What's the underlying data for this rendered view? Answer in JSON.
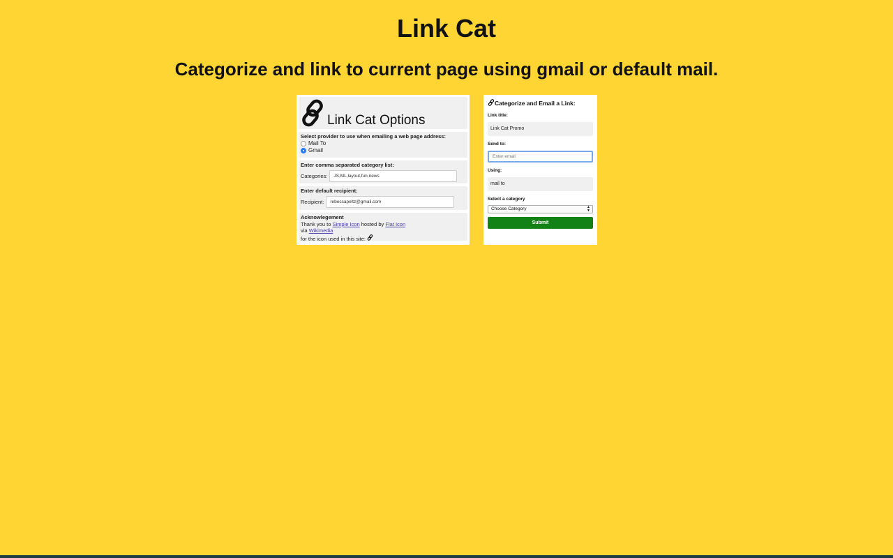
{
  "page": {
    "title": "Link Cat",
    "subtitle": "Categorize and link to current page using gmail or default mail.",
    "background_color": "#ffd533"
  },
  "options_panel": {
    "header_title": "Link Cat Options",
    "header_icon": "link-icon",
    "provider_label": "Select provider to use when emailing a web page address:",
    "providers": [
      {
        "label": "Mail To",
        "selected": false
      },
      {
        "label": "Gmail",
        "selected": true
      }
    ],
    "category_section_label": "Enter comma separated category list:",
    "categories_label": "Categories:",
    "categories_value": "JS,ML,layout,fun,news",
    "recipient_section_label": "Enter default recipient:",
    "recipient_label": "Recipient:",
    "recipient_value": "rebeccapeltz@gmail.com",
    "ack_title": "Acknowlegement",
    "ack_text_1": "Thank you to",
    "ack_link_1": "Simple Icon",
    "ack_text_2": "hosted by",
    "ack_link_2": "Flat Icon",
    "ack_text_3": "via",
    "ack_link_3": "Wikimedia",
    "ack_text_4": "for the icon used in this site:"
  },
  "popup_panel": {
    "title": "Categorize and Email a Link:",
    "link_title_label": "Link title:",
    "link_title_value": "Link Cat Promo",
    "send_to_label": "Send to:",
    "send_to_placeholder": "Enter email",
    "using_label": "Using:",
    "using_value": "mail to",
    "category_label": "Select a category",
    "category_selected": "Choose Category",
    "submit_label": "Submit",
    "submit_color": "#128216"
  }
}
